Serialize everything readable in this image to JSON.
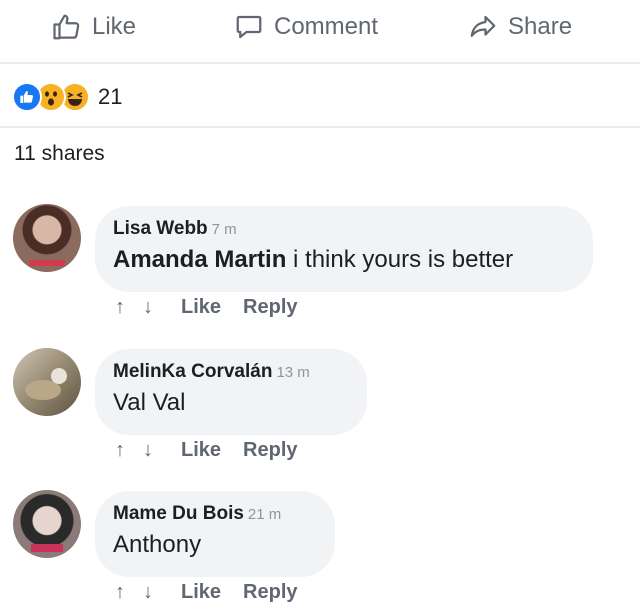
{
  "actions": {
    "like": "Like",
    "comment": "Comment",
    "share": "Share"
  },
  "reactions": {
    "icons": [
      "like-reaction-icon",
      "wow-reaction-icon",
      "haha-reaction-icon"
    ],
    "count": "21",
    "colors": {
      "like": "#1877f2",
      "wow": "#f7b125",
      "haha": "#f7b125"
    }
  },
  "shares": "11 shares",
  "comments": [
    {
      "author": "Lisa Webb",
      "time": "7 m",
      "mention": "Amanda Martin",
      "text": " i think yours is better",
      "like": "Like",
      "reply": "Reply",
      "up": "↑",
      "down": "↓"
    },
    {
      "author": "MelinKa Corvalán",
      "time": "13 m",
      "mention": "",
      "text": "Val Val",
      "like": "Like",
      "reply": "Reply",
      "up": "↑",
      "down": "↓"
    },
    {
      "author": "Mame Du Bois",
      "time": "21 m",
      "mention": "",
      "text": "Anthony",
      "like": "Like",
      "reply": "Reply",
      "up": "↑",
      "down": "↓"
    }
  ]
}
